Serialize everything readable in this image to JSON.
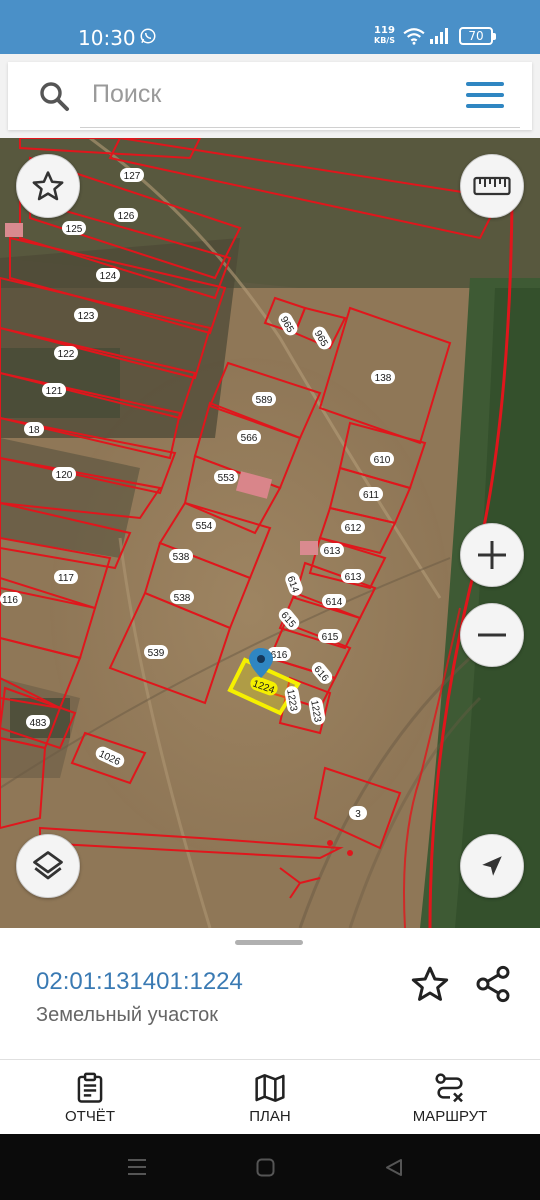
{
  "status_bar": {
    "time": "10:30",
    "net_speed_value": "119",
    "net_speed_unit": "KB/S",
    "battery": "70",
    "icons": [
      "whatsapp-icon",
      "wifi-icon",
      "signal-icon",
      "battery-icon"
    ]
  },
  "search": {
    "placeholder": "Поиск"
  },
  "map": {
    "buttons": [
      "favorite-star-icon",
      "ruler-icon",
      "zoom-in-icon",
      "zoom-out-icon",
      "layers-icon",
      "locate-icon"
    ],
    "parcel_labels": [
      "127",
      "126",
      "125",
      "124",
      "123",
      "122",
      "121",
      "18",
      "120",
      "117",
      "116",
      "483",
      "1026",
      "965",
      "965",
      "138",
      "589",
      "566",
      "553",
      "554",
      "538",
      "538",
      "539",
      "610",
      "611",
      "612",
      "613",
      "613",
      "614",
      "614",
      "615",
      "615",
      "616",
      "616",
      "1223",
      "1223",
      "1224",
      "3"
    ],
    "highlight_color": "#f5f000",
    "boundary_color": "#e0161c"
  },
  "sheet": {
    "cadastral_number": "02:01:131401:1224",
    "object_type": "Земельный участок"
  },
  "bottom_nav": {
    "report_label": "ОТЧЁТ",
    "plan_label": "ПЛАН",
    "route_label": "МАРШРУТ"
  },
  "colors": {
    "accent": "#2f86c2",
    "status_bar": "#4a90c8",
    "link": "#3a7ab3"
  }
}
